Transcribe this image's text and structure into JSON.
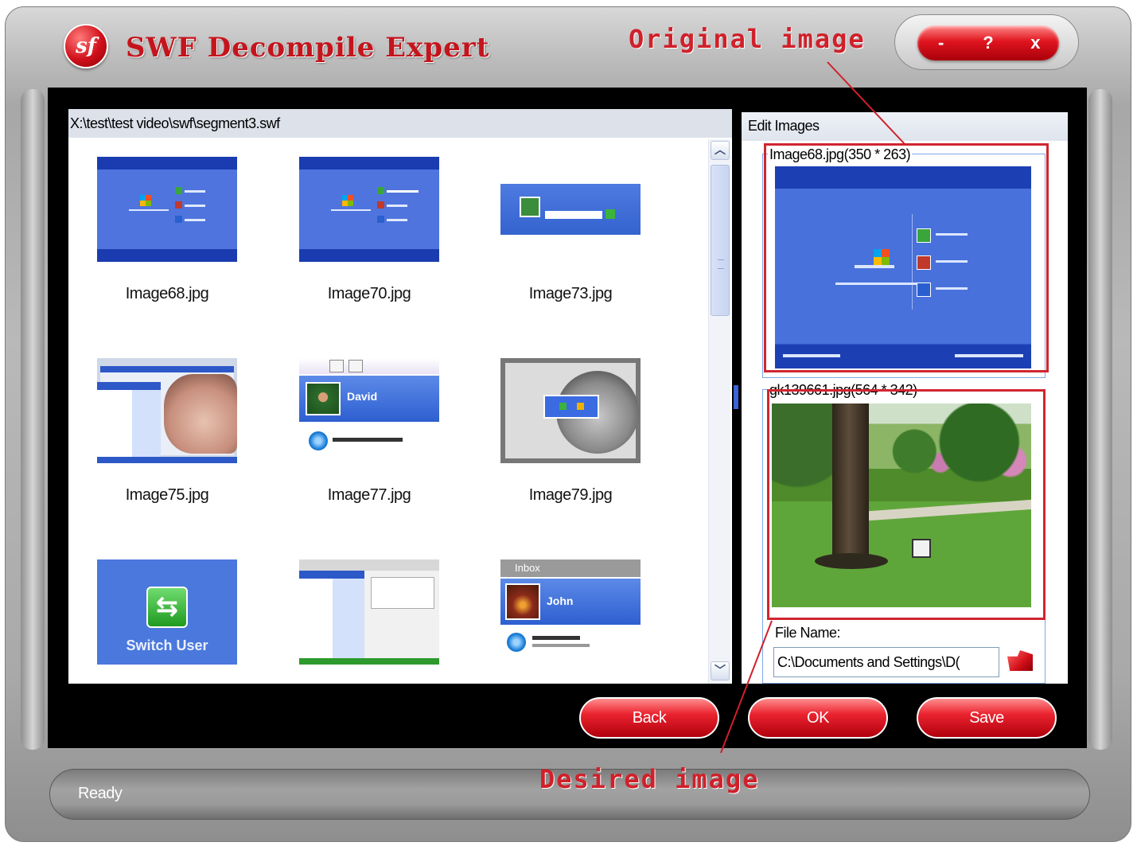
{
  "app": {
    "title": "SWF Decompile Expert",
    "logo_text": "sf",
    "window_buttons": [
      "-",
      "?",
      "x"
    ]
  },
  "browser": {
    "path": "X:\\test\\test video\\swf\\segment3.swf",
    "thumbnails": [
      {
        "label": "Image68.jpg",
        "icon": "xp-welcome-thumbnail"
      },
      {
        "label": "Image70.jpg",
        "icon": "xp-welcome-thumbnail"
      },
      {
        "label": "Image73.jpg",
        "icon": "xp-login-thumbnail"
      },
      {
        "label": "Image75.jpg",
        "icon": "desktop-startmenu-thumbnail"
      },
      {
        "label": "Image77.jpg",
        "icon": "user-david-thumbnail"
      },
      {
        "label": "Image79.jpg",
        "icon": "grayscale-dialog-thumbnail"
      },
      {
        "label": "",
        "icon": "switch-user-thumbnail",
        "caption": "Switch User"
      },
      {
        "label": "",
        "icon": "explorer-thumbnail"
      },
      {
        "label": "",
        "icon": "inbox-john-thumbnail",
        "header": "Inbox",
        "name": "John"
      }
    ],
    "thumb_texts": {
      "david_name": "David",
      "switch_user": "Switch User",
      "inbox": "Inbox",
      "john": "John"
    }
  },
  "edit_panel": {
    "title": "Edit Images",
    "original_legend": "Image68.jpg(350 * 263)",
    "desired_legend": "gk139661.jpg(564 * 342)",
    "file_name_label": "File Name:",
    "file_name_value": "C:\\Documents and Settings\\D("
  },
  "actions": {
    "back": "Back",
    "ok": "OK",
    "save": "Save"
  },
  "status": {
    "text": "Ready"
  },
  "annotations": {
    "original": "Original image",
    "desired": "Desired image"
  },
  "colors": {
    "accent_red": "#d0202a",
    "xp_blue": "#4f74dd",
    "body_black": "#000000"
  }
}
